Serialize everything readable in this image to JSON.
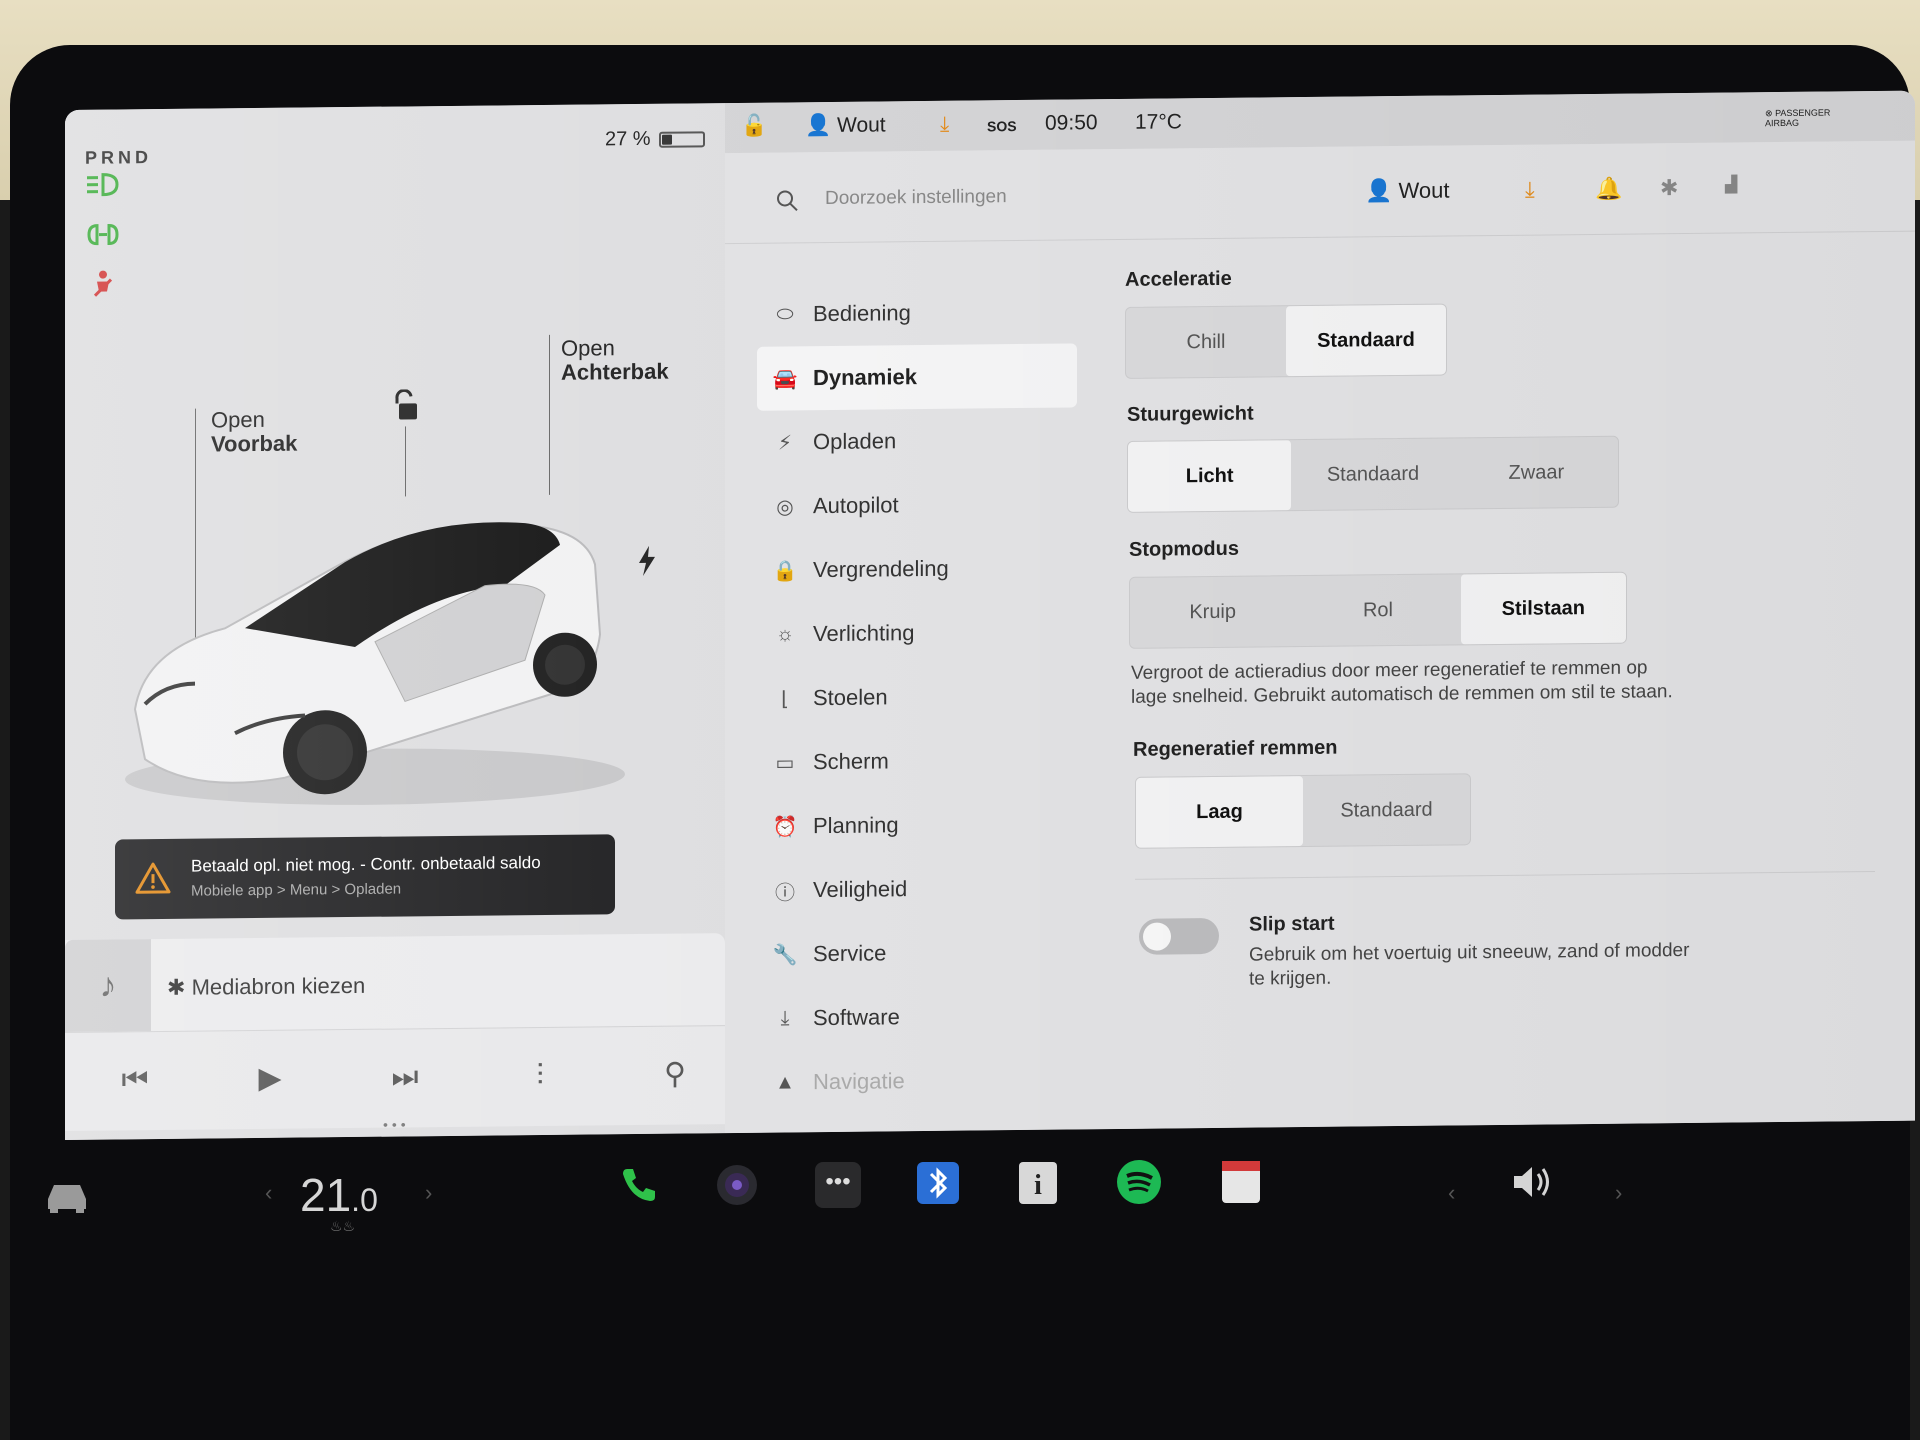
{
  "car_panel": {
    "gear": "PRND",
    "battery_percent": "27 %",
    "battery_level": 0.27,
    "frunk_label_1": "Open",
    "frunk_label_2": "Voorbak",
    "trunk_label_1": "Open",
    "trunk_label_2": "Achterbak",
    "alert_title": "Betaald opl. niet mog. - Contr. onbetaald saldo",
    "alert_sub": "Mobiele app > Menu > Opladen",
    "media_source": "Mediabron kiezen"
  },
  "status_bar": {
    "user": "Wout",
    "sos": "SOS",
    "time": "09:50",
    "temperature": "17°C",
    "airbag": "PASSENGER AIRBAG"
  },
  "settings": {
    "search_placeholder": "Doorzoek instellingen",
    "header_user": "Wout",
    "menu": [
      {
        "label": "Bediening",
        "icon": "toggle-icon"
      },
      {
        "label": "Dynamiek",
        "icon": "car-icon"
      },
      {
        "label": "Opladen",
        "icon": "bolt-icon"
      },
      {
        "label": "Autopilot",
        "icon": "steering-wheel-icon"
      },
      {
        "label": "Vergrendeling",
        "icon": "lock-icon"
      },
      {
        "label": "Verlichting",
        "icon": "sun-icon"
      },
      {
        "label": "Stoelen",
        "icon": "seat-icon"
      },
      {
        "label": "Scherm",
        "icon": "display-icon"
      },
      {
        "label": "Planning",
        "icon": "alarm-icon"
      },
      {
        "label": "Veiligheid",
        "icon": "alert-circle-icon"
      },
      {
        "label": "Service",
        "icon": "wrench-icon"
      },
      {
        "label": "Software",
        "icon": "download-icon"
      },
      {
        "label": "Navigatie",
        "icon": "navigation-icon"
      }
    ],
    "acceleratie": {
      "title": "Acceleratie",
      "options": [
        "Chill",
        "Standaard"
      ],
      "selected": "Standaard"
    },
    "stuurgewicht": {
      "title": "Stuurgewicht",
      "options": [
        "Licht",
        "Standaard",
        "Zwaar"
      ],
      "selected": "Licht"
    },
    "stopmodus": {
      "title": "Stopmodus",
      "options": [
        "Kruip",
        "Rol",
        "Stilstaan"
      ],
      "selected": "Stilstaan",
      "description_1": "Vergroot de actieradius door meer regeneratief te remmen op",
      "description_2": "lage snelheid. Gebruikt automatisch de remmen om stil te staan."
    },
    "regeneratief": {
      "title": "Regeneratief remmen",
      "options": [
        "Laag",
        "Standaard"
      ],
      "selected": "Laag"
    },
    "slip_start": {
      "title": "Slip start",
      "description_1": "Gebruik om het voertuig uit sneeuw, zand of modder",
      "description_2": "te krijgen."
    }
  },
  "dock": {
    "temp_main": "21",
    "temp_decimal": ".0"
  },
  "colors": {
    "spotify": "#1db954",
    "bluetooth": "#2b6fd6",
    "phone": "#2fc24a",
    "warning_orange": "#e38b1a",
    "warning_red": "#d23a3a",
    "lights_green": "#3fae3f"
  }
}
